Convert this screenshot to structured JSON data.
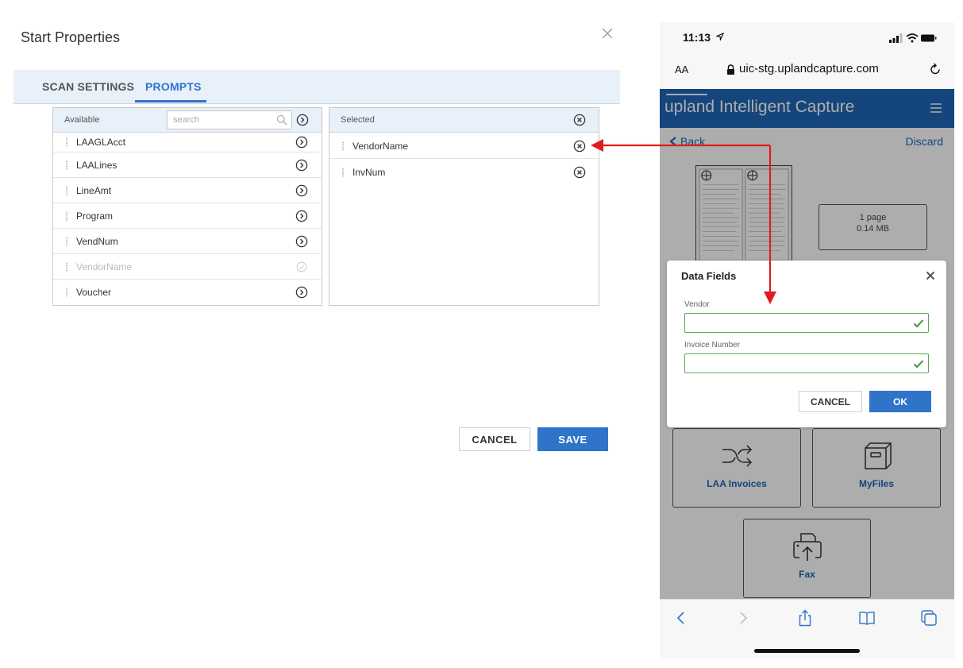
{
  "dialog": {
    "title": "Start Properties",
    "tabs": [
      {
        "label": "SCAN SETTINGS",
        "active": false
      },
      {
        "label": "PROMPTS",
        "active": true
      }
    ],
    "available": {
      "header": "Available",
      "search_placeholder": "search",
      "items": [
        {
          "label": "LAAGLAcct",
          "disabled": false
        },
        {
          "label": "LAALines",
          "disabled": false
        },
        {
          "label": "LineAmt",
          "disabled": false
        },
        {
          "label": "Program",
          "disabled": false
        },
        {
          "label": "VendNum",
          "disabled": false
        },
        {
          "label": "VendorName",
          "disabled": true
        },
        {
          "label": "Voucher",
          "disabled": false
        }
      ]
    },
    "selected": {
      "header": "Selected",
      "items": [
        {
          "label": "VendorName"
        },
        {
          "label": "InvNum"
        }
      ]
    },
    "buttons": {
      "cancel": "CANCEL",
      "save": "SAVE"
    },
    "accent_color": "#2f74c9"
  },
  "phone": {
    "status": {
      "time": "11:13"
    },
    "browser": {
      "text_size": "AA",
      "url": "uic-stg.uplandcapture.com"
    },
    "app": {
      "brand": "upland Intelligent Capture",
      "back": "Back",
      "discard": "Discard",
      "doc_info": {
        "pages": "1 page",
        "size": "0.14 MB"
      },
      "tiles": [
        {
          "label": "LAA Invoices",
          "icon": "shuffle-icon"
        },
        {
          "label": "MyFiles",
          "icon": "file-box-icon"
        },
        {
          "label": "Fax",
          "icon": "fax-icon"
        }
      ],
      "header_color": "#1e66b8"
    },
    "modal": {
      "title": "Data Fields",
      "fields": [
        {
          "label": "Vendor",
          "value": ""
        },
        {
          "label": "Invoice Number",
          "value": ""
        }
      ],
      "cancel": "CANCEL",
      "ok": "OK"
    }
  }
}
